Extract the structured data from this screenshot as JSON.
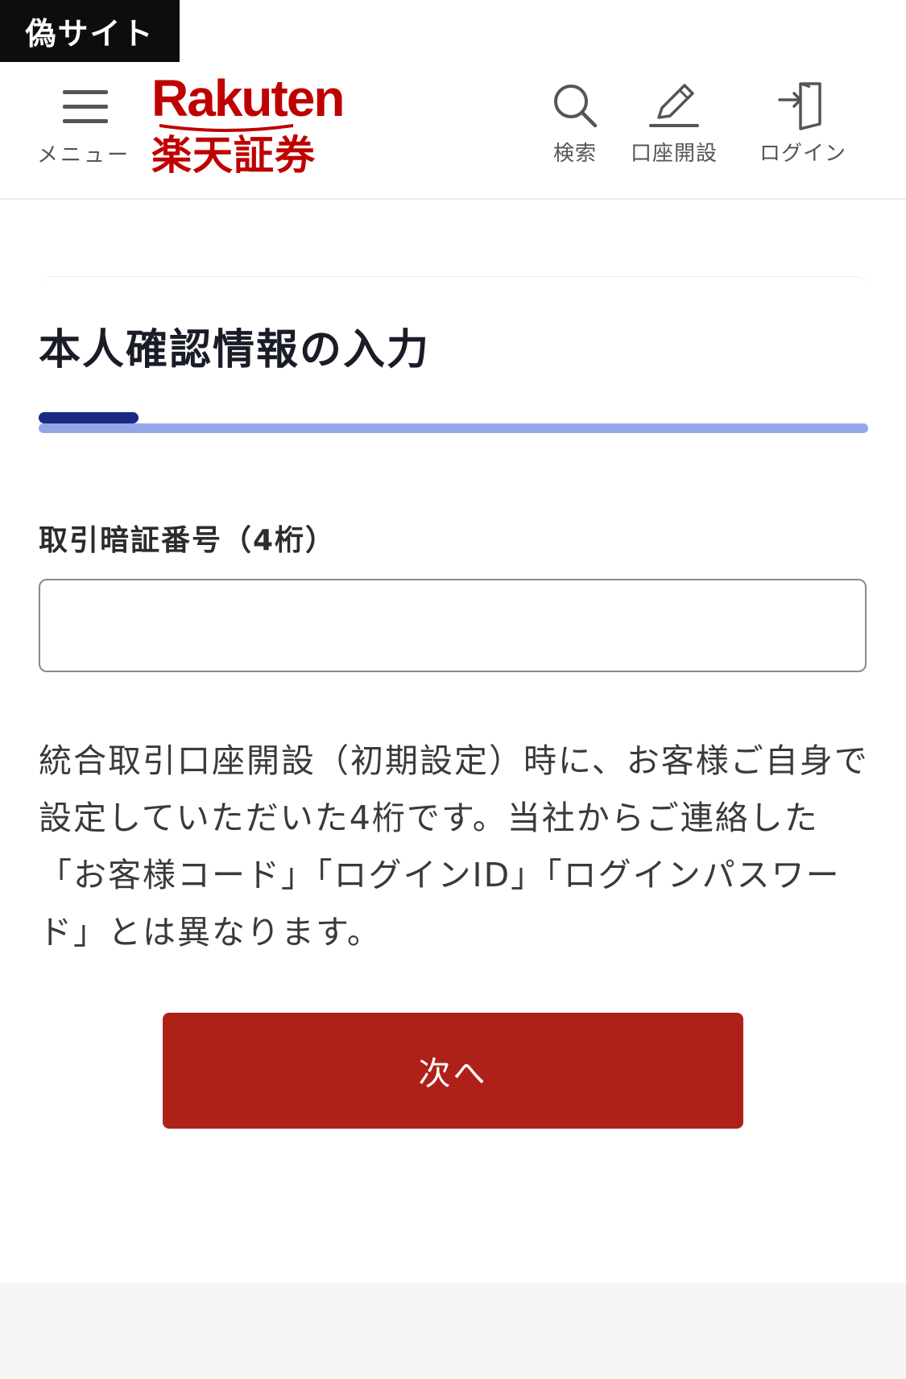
{
  "warning_tag": "偽サイト",
  "header": {
    "menu_label": "メニュー",
    "logo": {
      "en": "Rakuten",
      "jp": "楽天証券",
      "color": "#bf0000"
    },
    "actions": [
      {
        "icon": "search-icon",
        "label": "検索"
      },
      {
        "icon": "pen-icon",
        "label": "口座開設"
      },
      {
        "icon": "login-door-icon",
        "label": "ログイン"
      }
    ]
  },
  "main": {
    "title": "本人確認情報の入力",
    "progress_fraction": 0.12,
    "field": {
      "label": "取引暗証番号（4桁）",
      "value": "",
      "placeholder": ""
    },
    "help_text": "統合取引口座開設（初期設定）時に、お客様ご自身で設定していただいた4桁です。当社からご連絡した「お客様コード」「ログインID」「ログインパスワード」とは異なります。",
    "next_button": "次へ"
  },
  "colors": {
    "brand": "#bf0000",
    "button": "#ae2119",
    "progress_fill": "#1a2a80",
    "progress_track": "#93a6ea",
    "title": "#1a1d28"
  }
}
